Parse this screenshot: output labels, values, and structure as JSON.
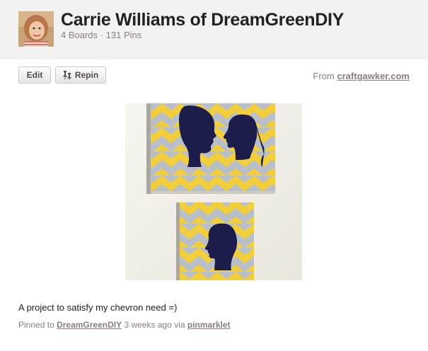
{
  "profile": {
    "name": "Carrie Williams of DreamGreenDIY",
    "boards": "4 Boards",
    "separator": "·",
    "pins": "131 Pins"
  },
  "actions": {
    "edit_label": "Edit",
    "repin_label": "Repin"
  },
  "source": {
    "prefix": "From",
    "domain": "craftgawker.com"
  },
  "pin": {
    "description": "A project to satisfy my chevron need =)",
    "pinned_to_prefix": "Pinned to",
    "board_name": "DreamGreenDIY",
    "time_via": "3 weeks ago via",
    "via_source": "pinmarklet"
  },
  "colors": {
    "header_bg": "#f2f2f2",
    "chevron_yellow": "#f2cf3a",
    "chevron_gray": "#b9bfc8",
    "silhouette_navy": "#1c1d4a",
    "link_gray": "#8c7e7e"
  }
}
